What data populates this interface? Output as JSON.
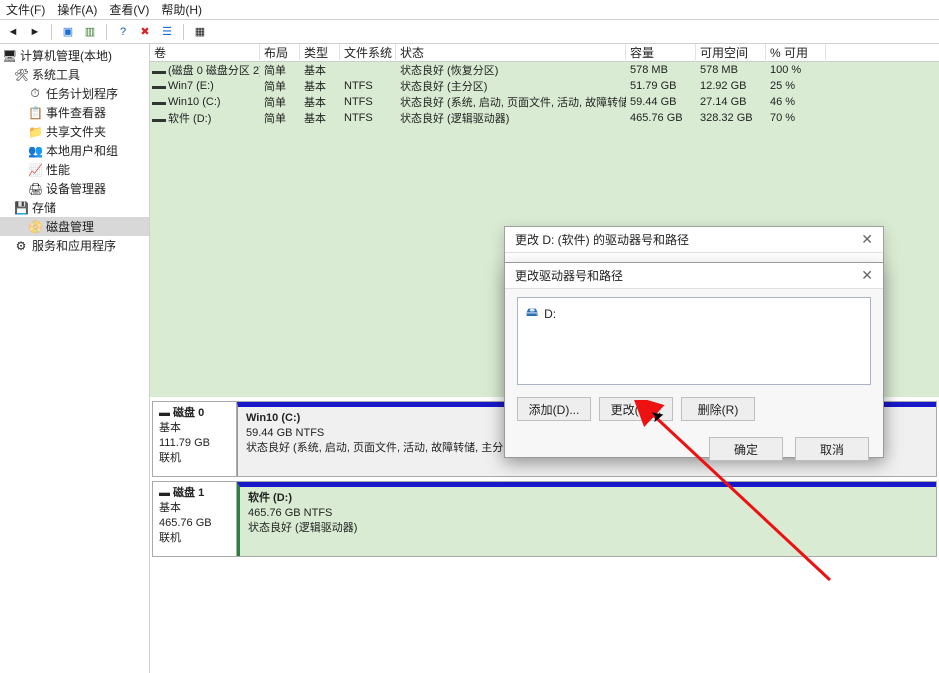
{
  "menu": {
    "file": "文件(F)",
    "action": "操作(A)",
    "view": "查看(V)",
    "help": "帮助(H)"
  },
  "sidebar": {
    "root": "计算机管理(本地)",
    "systools": "系统工具",
    "items": [
      {
        "label": "任务计划程序"
      },
      {
        "label": "事件查看器"
      },
      {
        "label": "共享文件夹"
      },
      {
        "label": "本地用户和组"
      },
      {
        "label": "性能"
      },
      {
        "label": "设备管理器"
      }
    ],
    "storage": "存储",
    "diskmgmt": "磁盘管理",
    "services": "服务和应用程序"
  },
  "vol_head": {
    "c0": "卷",
    "c1": "布局",
    "c2": "类型",
    "c3": "文件系统",
    "c4": "状态",
    "c5": "容量",
    "c6": "可用空间",
    "c7": "% 可用"
  },
  "volumes": [
    {
      "name": "(磁盘 0 磁盘分区 2)",
      "layout": "简单",
      "type": "基本",
      "fs": "",
      "status": "状态良好 (恢复分区)",
      "cap": "578 MB",
      "free": "578 MB",
      "pct": "100 %"
    },
    {
      "name": "Win7 (E:)",
      "layout": "简单",
      "type": "基本",
      "fs": "NTFS",
      "status": "状态良好 (主分区)",
      "cap": "51.79 GB",
      "free": "12.92 GB",
      "pct": "25 %"
    },
    {
      "name": "Win10 (C:)",
      "layout": "简单",
      "type": "基本",
      "fs": "NTFS",
      "status": "状态良好 (系统, 启动, 页面文件, 活动, 故障转储, 主分区)",
      "cap": "59.44 GB",
      "free": "27.14 GB",
      "pct": "46 %"
    },
    {
      "name": "软件 (D:)",
      "layout": "简单",
      "type": "基本",
      "fs": "NTFS",
      "status": "状态良好 (逻辑驱动器)",
      "cap": "465.76 GB",
      "free": "328.32 GB",
      "pct": "70 %"
    }
  ],
  "disks": [
    {
      "title": "磁盘 0",
      "kind": "基本",
      "size": "111.79 GB",
      "state": "联机",
      "parts": [
        {
          "title": "Win10  (C:)",
          "sub": "59.44 GB NTFS",
          "status": "状态良好 (系统, 启动, 页面文件, 活动, 故障转储, 主分区)"
        }
      ]
    },
    {
      "title": "磁盘 1",
      "kind": "基本",
      "size": "465.76 GB",
      "state": "联机",
      "parts": [
        {
          "title": "软件  (D:)",
          "sub": "465.76 GB NTFS",
          "status": "状态良好 (逻辑驱动器)"
        }
      ]
    }
  ],
  "dlg1": {
    "title": "更改 D: (软件) 的驱动器号和路径"
  },
  "dlg2": {
    "title": "更改驱动器号和路径",
    "entry": "D:",
    "add": "添加(D)...",
    "change": "更改(C)...",
    "remove": "删除(R)",
    "ok": "确定",
    "cancel": "取消"
  }
}
